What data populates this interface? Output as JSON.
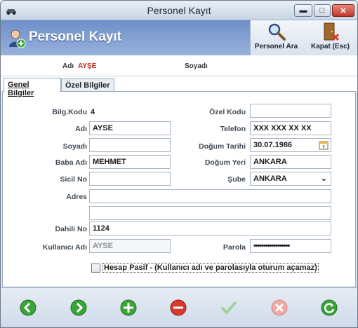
{
  "window": {
    "title": "Personel Kayıt"
  },
  "header": {
    "title": "Personel Kayıt"
  },
  "toolbar": {
    "search_label": "Personel Ara",
    "close_label": "Kapat (Esc)"
  },
  "infobar": {
    "name_label": "Adı",
    "name_value": "AYŞE",
    "surname_label": "Soyadı",
    "surname_value": ""
  },
  "tabs": [
    {
      "label": "Genel Bilgiler",
      "active": true
    },
    {
      "label": "Özel Bilgiler",
      "active": false
    }
  ],
  "form": {
    "bilg_kodu": {
      "label": "Bilg.Kodu",
      "value": "4"
    },
    "adi": {
      "label": "Adı",
      "value": "AYSE"
    },
    "soyadi": {
      "label": "Soyadı",
      "value": ""
    },
    "baba_adi": {
      "label": "Baba Adı",
      "value": "MEHMET"
    },
    "sicil_no": {
      "label": "Sicil No",
      "value": ""
    },
    "adres": {
      "label": "Adres",
      "line1": "",
      "line2": ""
    },
    "dahili_no": {
      "label": "Dahili No",
      "value": "1124"
    },
    "kullanici_adi": {
      "label": "Kullanıcı Adı",
      "value": "AYSE"
    },
    "ozel_kodu": {
      "label": "Özel Kodu",
      "value": ""
    },
    "telefon": {
      "label": "Telefon",
      "value": "XXX XXX XX XX"
    },
    "dogum_tarihi": {
      "label": "Doğum Tarihi",
      "value": "30.07.1986"
    },
    "dogum_yeri": {
      "label": "Doğum Yeri",
      "value": "ANKARA"
    },
    "sube": {
      "label": "Şube",
      "value": "ANKARA"
    },
    "parola": {
      "label": "Parola",
      "value": "••••••••••••••••••"
    },
    "hesap_pasif": {
      "label": "Hesap Pasif - (Kullanıcı adı ve parolasıyla oturum açamaz)",
      "checked": false
    }
  },
  "colors": {
    "header_blue": "#7b98cf",
    "accent_red": "#c0271a",
    "nav_green": "#3aa33a",
    "delete_red": "#d83a2c"
  },
  "icons": {
    "back": "arrow-left-icon",
    "forward": "arrow-right-icon",
    "add": "plus-icon",
    "remove": "minus-icon",
    "save": "check-icon",
    "cancel": "cross-icon",
    "refresh": "refresh-icon"
  }
}
